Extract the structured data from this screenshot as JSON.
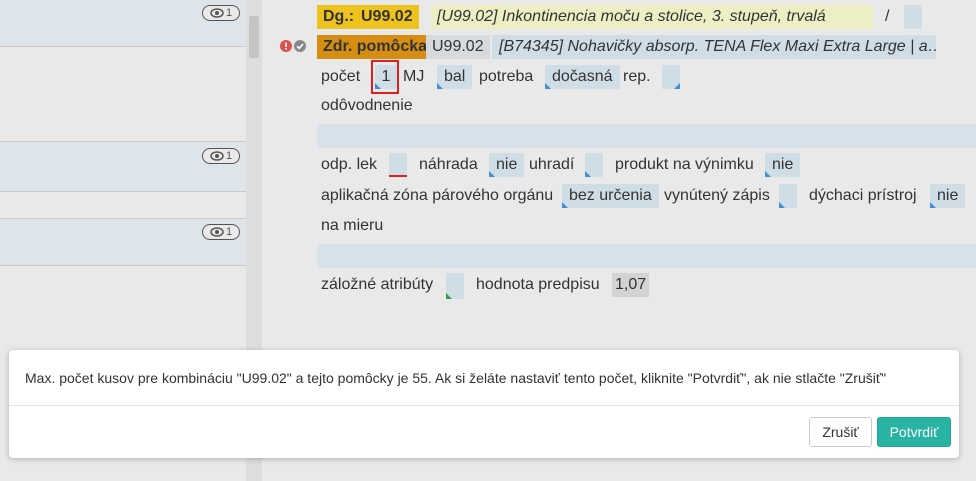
{
  "left_list": {
    "rows": [
      {
        "badge": "1"
      },
      {
        "badge": "1"
      },
      {
        "badge": "1"
      }
    ]
  },
  "prescription": {
    "dg_label": "Dg.:",
    "dg_code": "U99.02",
    "dg_text": "[U99.02] Inkontinencia moču a stolice, 3. stupeň, trvalá",
    "slash": "/",
    "aid_label": "Zdr. pomôcka:",
    "aid_code": "U99.02",
    "aid_text": "[B74345] Nohavičky absorp. TENA Flex Maxi Extra Large | a…",
    "count_label": "počet",
    "count_value": "1",
    "unit_label": "MJ",
    "unit_value": "bal",
    "need_label": "potreba",
    "need_value": "dočasná",
    "rep_label": "rep.",
    "justification_label": "odôvodnenie",
    "drug_label": "odp. lek",
    "replacement_label": "náhrada",
    "replacement_value": "nie",
    "pays_label": "uhradí",
    "exception_label": "produkt na výnimku",
    "exception_value": "nie",
    "zone_label": "aplikačná zóna párového orgánu",
    "zone_value": "bez určenia",
    "forced_label": "vynútený zápis",
    "breathing_label": "dýchaci prístroj",
    "breathing_value": "nie",
    "custom_label": "na mieru",
    "backup_label": "záložné atribúty",
    "rx_value_label": "hodnota predpisu",
    "rx_value": "1,07"
  },
  "dialog": {
    "message": "Max. počet kusov pre kombináciu \"U99.02\" a tejto pomôcky je 55. Ak si želáte nastaviť tento počet, kliknite \"Potvrdiť\", ak nie stlačte \"Zrušiť\"",
    "cancel_label": "Zrušiť",
    "confirm_label": "Potvrdiť"
  },
  "colors": {
    "accent": "#28b3a3",
    "dg_badge": "#efc31f",
    "aid_badge": "#d58e12",
    "error": "#d9534f"
  }
}
